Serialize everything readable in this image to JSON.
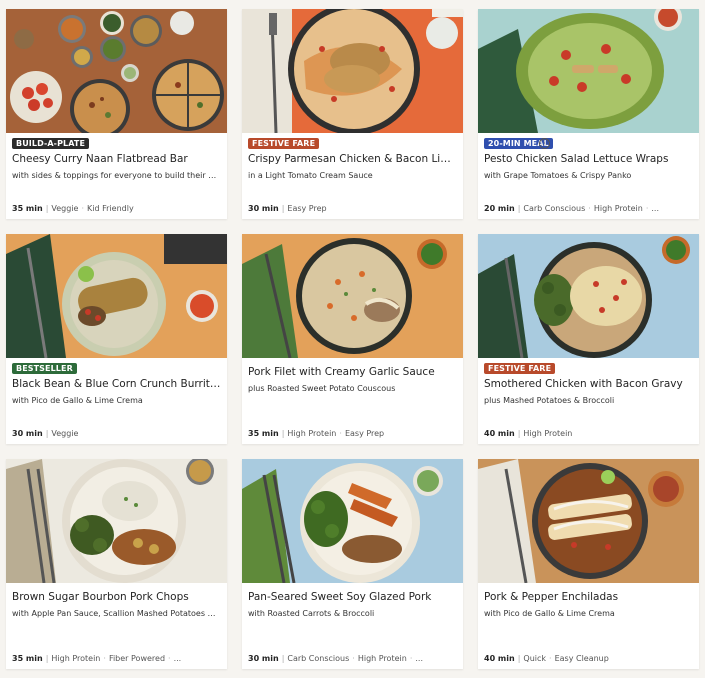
{
  "colors": {
    "badge_build": "#2b2b2b",
    "badge_festive": "#b84a2b",
    "badge_20min": "#2f4fae",
    "badge_bestseller": "#2d6b3a"
  },
  "recipes": [
    {
      "badge": "BUILD-A-PLATE",
      "badge_color": "#2b2b2b",
      "title": "Cheesy Curry Naan Flatbread Bar",
      "subtitle": "with sides & toppings for everyone to build their pe...",
      "time": "35 min",
      "tags": "Veggie · Kid Friendly"
    },
    {
      "badge": "FESTIVE FARE",
      "badge_color": "#b84a2b",
      "title": "Crispy Parmesan Chicken & Bacon Lingu...",
      "subtitle": "in a Light Tomato Cream Sauce",
      "time": "30 min",
      "tags": "Easy Prep"
    },
    {
      "badge": "20-MIN MEAL",
      "badge_color": "#2f4fae",
      "info_icon": "ⓘ",
      "title": "Pesto Chicken Salad Lettuce Wraps",
      "subtitle": "with Grape Tomatoes & Crispy Panko",
      "time": "20 min",
      "tags": "Carb Conscious · High Protein · ..."
    },
    {
      "badge": "BESTSELLER",
      "badge_color": "#2d6b3a",
      "title": "Black Bean & Blue Corn Crunch Burritos",
      "subtitle": "with Pico de Gallo & Lime Crema",
      "time": "30 min",
      "tags": "Veggie"
    },
    {
      "badge": "",
      "badge_color": "",
      "title": "Pork Filet with Creamy Garlic Sauce",
      "subtitle": "plus Roasted Sweet Potato Couscous",
      "time": "35 min",
      "tags": "High Protein · Easy Prep"
    },
    {
      "badge": "FESTIVE FARE",
      "badge_color": "#b84a2b",
      "title": "Smothered Chicken with Bacon Gravy",
      "subtitle": "plus Mashed Potatoes & Broccoli",
      "time": "40 min",
      "tags": "High Protein"
    },
    {
      "badge": "",
      "badge_color": "",
      "title": "Brown Sugar Bourbon Pork Chops",
      "subtitle": "with Apple Pan Sauce, Scallion Mashed Potatoes & B...",
      "time": "35 min",
      "tags": "High Protein · Fiber Powered · ..."
    },
    {
      "badge": "",
      "badge_color": "",
      "title": "Pan-Seared Sweet Soy Glazed Pork",
      "subtitle": "with Roasted Carrots & Broccoli",
      "time": "30 min",
      "tags": "Carb Conscious · High Protein · ..."
    },
    {
      "badge": "",
      "badge_color": "",
      "title": "Pork & Pepper Enchiladas",
      "subtitle": "with Pico de Gallo & Lime Crema",
      "time": "40 min",
      "tags": "Quick · Easy Cleanup"
    }
  ]
}
